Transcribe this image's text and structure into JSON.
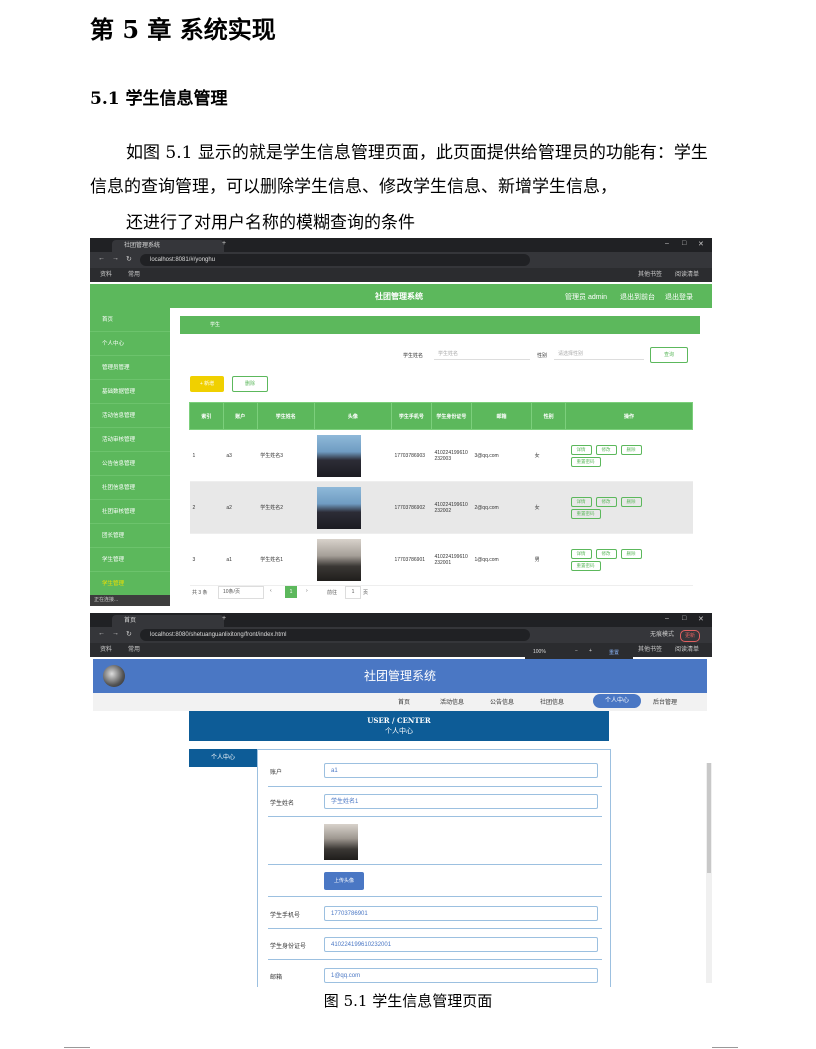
{
  "chapter_title": "第 5 章  系统实现",
  "section_title": "5.1 学生信息管理",
  "paragraph_1": "如图 5.1 显示的就是学生信息管理页面，此页面提供给管理员的功能有：学生信息的查询管理，可以删除学生信息、修改学生信息、新增学生信息，",
  "paragraph_2": "还进行了对用户名称的模糊查询的条件",
  "caption": "图 5.1 学生信息管理页面",
  "screenshot_admin": {
    "tab_title": "社团管理系统",
    "url": "localhost:8081/#/yonghu",
    "bookmarks": [
      "资料",
      "常用"
    ],
    "bookmarks_right": [
      "其他书签",
      "阅读清单"
    ],
    "app_title": "社团管理系统",
    "header_right": [
      "管理员 admin",
      "退出到前台",
      "退出登录"
    ],
    "sidebar": [
      "首页",
      "个人中心",
      "管理员管理",
      "基础数据管理",
      "活动信息管理",
      "活动审核管理",
      "公告信息管理",
      "社团信息管理",
      "社团审核管理",
      "团长管理",
      "学生管理",
      "学生管理"
    ],
    "status_text": "正在连接...",
    "breadcrumb": "学生",
    "search_label_1": "学生姓名",
    "search_placeholder_1": "学生姓名",
    "search_label_2": "性别",
    "search_placeholder_2": "请选择性别",
    "search_button": "查询",
    "add_button": "+ 新增",
    "delete_button": "删除",
    "columns": [
      "索引",
      "账户",
      "学生姓名",
      "头像",
      "学生手机号",
      "学生身份证号",
      "邮箱",
      "性别",
      "操作"
    ],
    "rows": [
      {
        "index": "1",
        "account": "a3",
        "name": "学生姓名3",
        "phone": "17703786903",
        "id_card": "410224199610232003",
        "email": "3@qq.com",
        "gender": "女"
      },
      {
        "index": "2",
        "account": "a2",
        "name": "学生姓名2",
        "phone": "17703786902",
        "id_card": "410224199610232002",
        "email": "2@qq.com",
        "gender": "女"
      },
      {
        "index": "3",
        "account": "a1",
        "name": "学生姓名1",
        "phone": "17703786901",
        "id_card": "410224199610232001",
        "email": "1@qq.com",
        "gender": "男"
      }
    ],
    "row_actions": [
      "详情",
      "修改",
      "删除",
      "重置密码"
    ],
    "pager": {
      "total": "共 3 条",
      "page_size": "10条/页",
      "current": "1",
      "goto_label": "前往",
      "goto_value": "1",
      "page_unit": "页"
    }
  },
  "screenshot_front": {
    "tab_title": "首页",
    "url": "localhost:8080/shetuanguanlixitong/front/index.html",
    "zoom": "100%",
    "zoom_reset": "重置",
    "bookmarks": [
      "资料",
      "常用"
    ],
    "bookmarks_right": [
      "其他书签",
      "阅读清单"
    ],
    "incognito": "无痕模式",
    "update": "更新",
    "site_title": "社团管理系统",
    "nav": [
      "首页",
      "活动信息",
      "公告信息",
      "社团信息",
      "个人中心",
      "后台管理"
    ],
    "banner_en": "USER / CENTER",
    "banner_cn": "个人中心",
    "left_menu": "个人中心",
    "fields": [
      {
        "label": "账户",
        "value": "a1"
      },
      {
        "label": "学生姓名",
        "value": "学生姓名1"
      },
      {
        "label": "学生手机号",
        "value": "17703786901"
      },
      {
        "label": "学生身份证号",
        "value": "410224199610232001"
      },
      {
        "label": "邮箱",
        "value": "1@qq.com"
      }
    ],
    "upload_button": "上传头像"
  }
}
